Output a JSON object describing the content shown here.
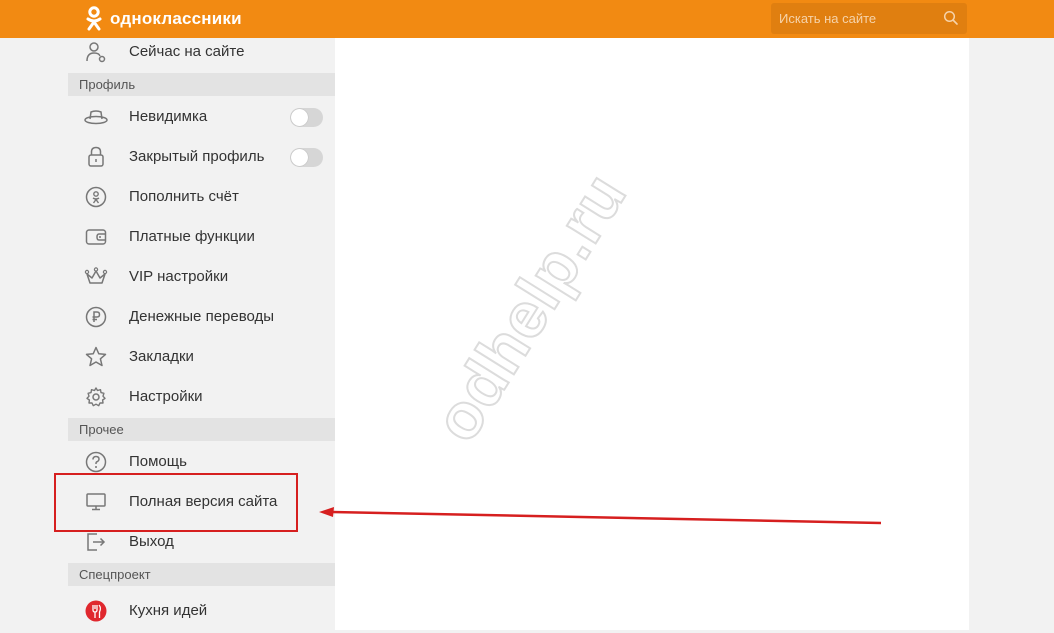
{
  "header": {
    "logo_text": "одноклассники",
    "search_placeholder": "Искать на сайте",
    "bg_color": "#f28a12"
  },
  "sidebar": {
    "top_item": {
      "label": "Сейчас на сайте",
      "icon": "person-online-icon"
    },
    "sections": [
      {
        "title": "Профиль",
        "items": [
          {
            "label": "Невидимка",
            "icon": "hat-icon",
            "toggle": false
          },
          {
            "label": "Закрытый профиль",
            "icon": "lock-icon",
            "toggle": false
          },
          {
            "label": "Пополнить счёт",
            "icon": "ok-coin-icon"
          },
          {
            "label": "Платные функции",
            "icon": "wallet-icon"
          },
          {
            "label": "VIP настройки",
            "icon": "crown-icon"
          },
          {
            "label": "Денежные переводы",
            "icon": "ruble-icon"
          },
          {
            "label": "Закладки",
            "icon": "star-icon"
          },
          {
            "label": "Настройки",
            "icon": "gear-icon"
          }
        ]
      },
      {
        "title": "Прочее",
        "items": [
          {
            "label": "Помощь",
            "icon": "help-icon"
          },
          {
            "label": "Полная версия сайта",
            "icon": "monitor-icon"
          },
          {
            "label": "Выход",
            "icon": "logout-icon"
          }
        ]
      },
      {
        "title": "Спецпроект",
        "items": [
          {
            "label": "Кухня идей",
            "icon": "kitchen-icon"
          }
        ]
      }
    ]
  },
  "watermark": "odhelp.ru",
  "annotation_color": "#d61f1f"
}
